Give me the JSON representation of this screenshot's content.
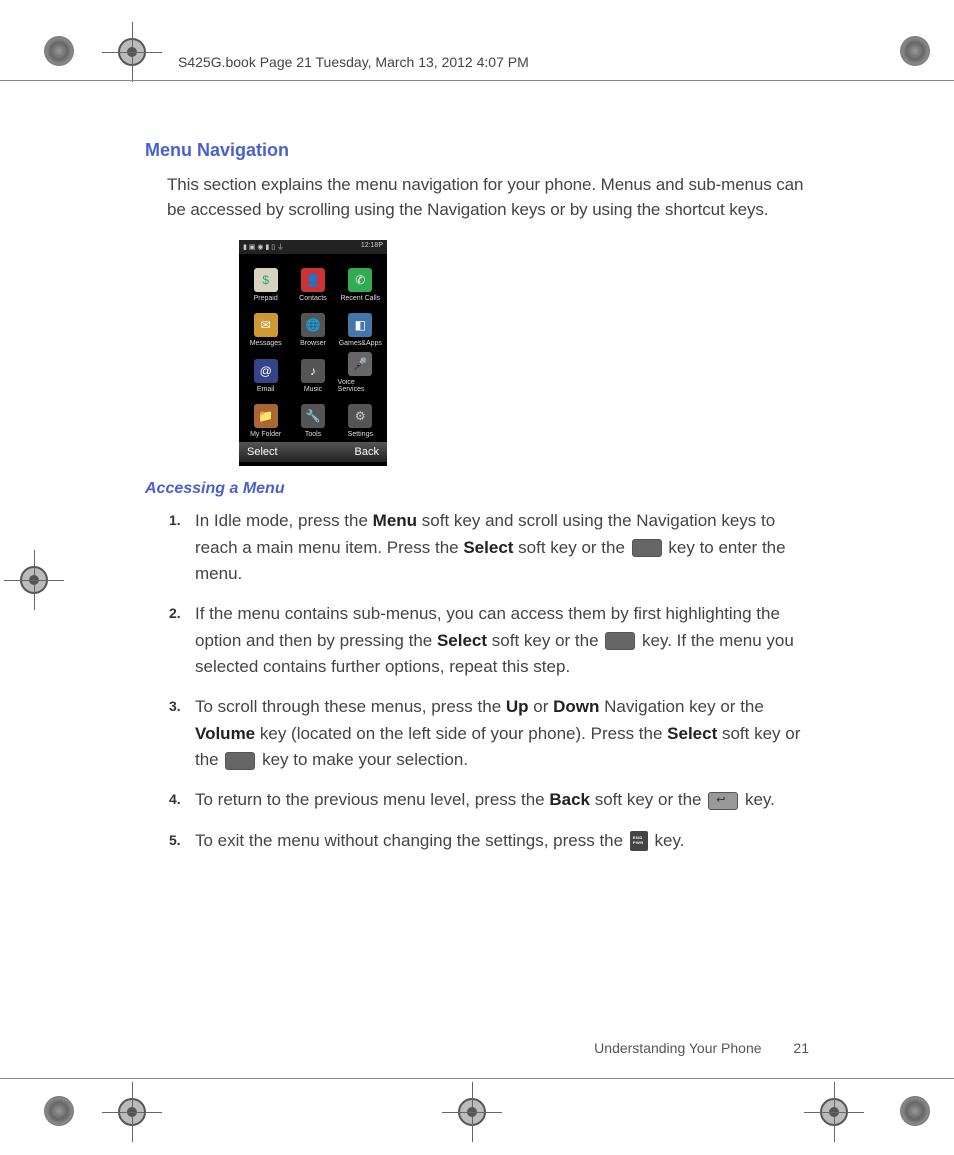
{
  "header": "S425G.book  Page 21  Tuesday, March 13, 2012  4:07 PM",
  "section_title": "Menu Navigation",
  "intro": "This section explains the menu navigation for your phone. Menus and sub-menus can be accessed by scrolling using the Navigation keys or by using the shortcut keys.",
  "subsection_title": "Accessing a Menu",
  "steps": [
    {
      "num": "1.",
      "parts": [
        {
          "t": "text",
          "v": "In Idle mode, press the "
        },
        {
          "t": "bold",
          "v": "Menu"
        },
        {
          "t": "text",
          "v": " soft key and scroll using the Navigation keys to reach a main menu item. Press the "
        },
        {
          "t": "bold",
          "v": "Select"
        },
        {
          "t": "text",
          "v": " soft key or the "
        },
        {
          "t": "key",
          "v": "ok"
        },
        {
          "t": "text",
          "v": " key to enter the menu."
        }
      ]
    },
    {
      "num": "2.",
      "parts": [
        {
          "t": "text",
          "v": "If the menu contains sub-menus, you can access them by first highlighting the option and then by pressing the "
        },
        {
          "t": "bold",
          "v": "Select"
        },
        {
          "t": "text",
          "v": " soft key or the "
        },
        {
          "t": "key",
          "v": "ok"
        },
        {
          "t": "text",
          "v": " key. If the menu you selected contains further options, repeat this step."
        }
      ]
    },
    {
      "num": "3.",
      "parts": [
        {
          "t": "text",
          "v": "To scroll through these menus, press the "
        },
        {
          "t": "bold",
          "v": "Up"
        },
        {
          "t": "text",
          "v": " or "
        },
        {
          "t": "bold",
          "v": "Down"
        },
        {
          "t": "text",
          "v": " Navigation key or the "
        },
        {
          "t": "bold",
          "v": "Volume"
        },
        {
          "t": "text",
          "v": " key (located on the left side of your phone). Press the "
        },
        {
          "t": "bold",
          "v": "Select"
        },
        {
          "t": "text",
          "v": " soft key or the "
        },
        {
          "t": "key",
          "v": "ok"
        },
        {
          "t": "text",
          "v": " key to make your selection."
        }
      ]
    },
    {
      "num": "4.",
      "parts": [
        {
          "t": "text",
          "v": "To return to the previous menu level, press the "
        },
        {
          "t": "bold",
          "v": "Back"
        },
        {
          "t": "text",
          "v": " soft key or the "
        },
        {
          "t": "key",
          "v": "back"
        },
        {
          "t": "text",
          "v": " key."
        }
      ]
    },
    {
      "num": "5.",
      "parts": [
        {
          "t": "text",
          "v": "To exit the menu without changing the settings, press the "
        },
        {
          "t": "key",
          "v": "end"
        },
        {
          "t": "text",
          "v": " key."
        }
      ]
    }
  ],
  "footer_section": "Understanding Your Phone",
  "footer_page": "21",
  "phone": {
    "time": "12:18P",
    "status_icons": "▮ ▣ ◉ ▮ ▯ ⏚",
    "cells": [
      {
        "label": "Prepaid",
        "glyph": "$",
        "bg": "#d8d2c0",
        "fg": "#2a6"
      },
      {
        "label": "Contacts",
        "glyph": "👤",
        "bg": "#c33",
        "fg": "#fff"
      },
      {
        "label": "Recent Calls",
        "glyph": "✆",
        "bg": "#3a5",
        "fg": "#fff"
      },
      {
        "label": "Messages",
        "glyph": "✉",
        "bg": "#c93",
        "fg": "#fff"
      },
      {
        "label": "Browser",
        "glyph": "🌐",
        "bg": "#555",
        "fg": "#9cf"
      },
      {
        "label": "Games&Apps",
        "glyph": "◧",
        "bg": "#47a",
        "fg": "#fff"
      },
      {
        "label": "Email",
        "glyph": "@",
        "bg": "#348",
        "fg": "#fff"
      },
      {
        "label": "Music",
        "glyph": "♪",
        "bg": "#555",
        "fg": "#fff"
      },
      {
        "label": "Voice Services",
        "glyph": "🎤",
        "bg": "#666",
        "fg": "#fff"
      },
      {
        "label": "My Folder",
        "glyph": "📁",
        "bg": "#a63",
        "fg": "#fff"
      },
      {
        "label": "Tools",
        "glyph": "🔧",
        "bg": "#555",
        "fg": "#fff"
      },
      {
        "label": "Settings",
        "glyph": "⚙",
        "bg": "#555",
        "fg": "#ccc"
      }
    ],
    "softkey_left": "Select",
    "softkey_right": "Back"
  }
}
